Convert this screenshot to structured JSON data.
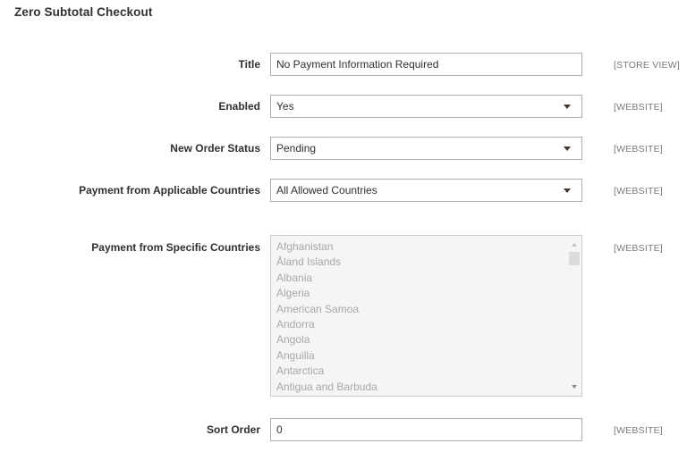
{
  "section": {
    "title": "Zero Subtotal Checkout"
  },
  "fields": {
    "title": {
      "label": "Title",
      "value": "No Payment Information Required",
      "scope": "[STORE VIEW]"
    },
    "enabled": {
      "label": "Enabled",
      "value": "Yes",
      "scope": "[WEBSITE]"
    },
    "new_order_status": {
      "label": "New Order Status",
      "value": "Pending",
      "scope": "[WEBSITE]"
    },
    "applicable_countries": {
      "label": "Payment from Applicable Countries",
      "value": "All Allowed Countries",
      "scope": "[WEBSITE]"
    },
    "specific_countries": {
      "label": "Payment from Specific Countries",
      "scope": "[WEBSITE]",
      "options": [
        "Afghanistan",
        "Åland Islands",
        "Albania",
        "Algeria",
        "American Samoa",
        "Andorra",
        "Angola",
        "Anguilla",
        "Antarctica",
        "Antigua and Barbuda"
      ]
    },
    "sort_order": {
      "label": "Sort Order",
      "value": "0",
      "scope": "[WEBSITE]"
    }
  },
  "icons": {
    "select_arrow": "chevron-down-icon",
    "scroll_up": "scroll-up-arrow-icon",
    "scroll_down": "scroll-down-arrow-icon"
  },
  "colors": {
    "text": "#303030",
    "scope_text": "#7a7a7a",
    "disabled_text": "#a8a8a8",
    "field_border": "#adadad",
    "disabled_bg": "#f5f5f5"
  }
}
